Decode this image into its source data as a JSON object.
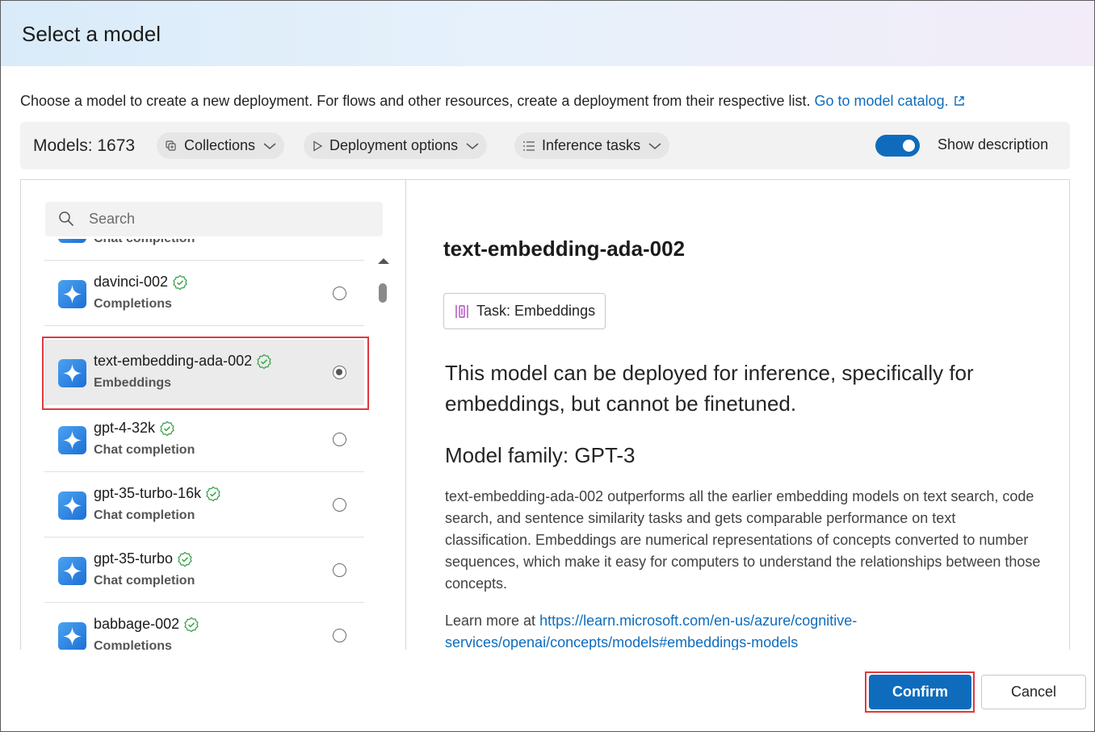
{
  "dialog": {
    "title": "Select a model",
    "intro_text": "Choose a model to create a new deployment. For flows and other resources, create a deployment from their respective list.",
    "catalog_link": "Go to model catalog."
  },
  "filters": {
    "models_count": "Models: 1673",
    "collections": "Collections",
    "deployment_options": "Deployment options",
    "inference_tasks": "Inference tasks",
    "show_description": "Show description",
    "show_description_on": true
  },
  "search": {
    "placeholder": "Search"
  },
  "models": [
    {
      "name": "",
      "task": "Chat completion",
      "selected": false
    },
    {
      "name": "davinci-002",
      "task": "Completions",
      "selected": false
    },
    {
      "name": "text-embedding-ada-002",
      "task": "Embeddings",
      "selected": true
    },
    {
      "name": "gpt-4-32k",
      "task": "Chat completion",
      "selected": false
    },
    {
      "name": "gpt-35-turbo-16k",
      "task": "Chat completion",
      "selected": false
    },
    {
      "name": "gpt-35-turbo",
      "task": "Chat completion",
      "selected": false
    },
    {
      "name": "babbage-002",
      "task": "Completions",
      "selected": false
    }
  ],
  "detail": {
    "title": "text-embedding-ada-002",
    "task_badge": "Task: Embeddings",
    "summary": "This model can be deployed for inference, specifically for embeddings, but cannot be finetuned.",
    "family": "Model family: GPT-3",
    "description": "text-embedding-ada-002 outperforms all the earlier embedding models on text search, code search, and sentence similarity tasks and gets comparable performance on text classification. Embeddings are numerical representations of concepts converted to number sequences, which make it easy for computers to understand the relationships between those concepts.",
    "learn_more_prefix": "Learn more at",
    "learn_more_link": "https://learn.microsoft.com/en-us/azure/cognitive-services/openai/concepts/models#embeddings-models"
  },
  "footer": {
    "confirm": "Confirm",
    "cancel": "Cancel"
  },
  "colors": {
    "accent": "#0f6cbd",
    "highlight_outline": "#e0383e",
    "verified": "#3aa34a"
  }
}
